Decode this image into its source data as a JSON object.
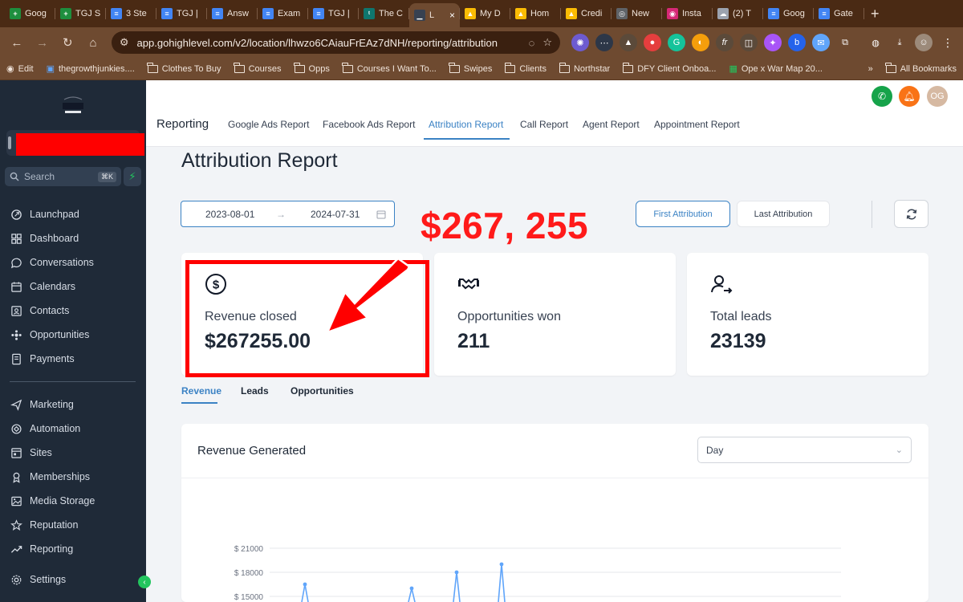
{
  "browser": {
    "tabs": [
      {
        "label": "Goog",
        "fav_color": "#1e8e3e",
        "fav_glyph": "+"
      },
      {
        "label": "TGJ S",
        "fav_color": "#1e8e3e",
        "fav_glyph": "+"
      },
      {
        "label": "3 Ste",
        "fav_color": "#4285f4",
        "fav_glyph": "≡"
      },
      {
        "label": "TGJ |",
        "fav_color": "#4285f4",
        "fav_glyph": "≡"
      },
      {
        "label": "Answ",
        "fav_color": "#4285f4",
        "fav_glyph": "≡"
      },
      {
        "label": "Exam",
        "fav_color": "#4285f4",
        "fav_glyph": "≡"
      },
      {
        "label": "TGJ |",
        "fav_color": "#4285f4",
        "fav_glyph": "≡"
      },
      {
        "label": "The C",
        "fav_color": "#0f766e",
        "fav_glyph": "ᵗ"
      },
      {
        "label": "L",
        "fav_color": "#374151",
        "fav_glyph": "▁",
        "active": true
      },
      {
        "label": "My D",
        "fav_color": "#fbbc04",
        "fav_glyph": "▲"
      },
      {
        "label": "Hom",
        "fav_color": "#fbbc04",
        "fav_glyph": "▲"
      },
      {
        "label": "Credi",
        "fav_color": "#fbbc04",
        "fav_glyph": "▲"
      },
      {
        "label": "New",
        "fav_color": "#5f6368",
        "fav_glyph": "◎"
      },
      {
        "label": "Insta",
        "fav_color": "#d62976",
        "fav_glyph": "◉"
      },
      {
        "label": "(2) T",
        "fav_color": "#9ca3af",
        "fav_glyph": "☁"
      },
      {
        "label": "Goog",
        "fav_color": "#4285f4",
        "fav_glyph": "≡"
      },
      {
        "label": "Gate",
        "fav_color": "#4285f4",
        "fav_glyph": "≡"
      }
    ],
    "url": "app.gohighlevel.com/v2/location/lhwzo6CAiauFrEAz7dNH/reporting/attribution",
    "bookmarks": [
      {
        "label": "Edit",
        "kind": "globe"
      },
      {
        "label": "thegrowthjunkies....",
        "kind": "app"
      },
      {
        "label": "Clothes To Buy",
        "kind": "folder"
      },
      {
        "label": "Courses",
        "kind": "folder"
      },
      {
        "label": "Opps",
        "kind": "folder"
      },
      {
        "label": "Courses I Want To...",
        "kind": "folder"
      },
      {
        "label": "Swipes",
        "kind": "folder"
      },
      {
        "label": "Clients",
        "kind": "folder"
      },
      {
        "label": "Northstar",
        "kind": "folder"
      },
      {
        "label": "DFY Client Onboa...",
        "kind": "folder"
      },
      {
        "label": "Ope x War Map 20...",
        "kind": "sheet"
      }
    ],
    "more_bookmarks": "»",
    "all_bookmarks": "All Bookmarks"
  },
  "sidebar": {
    "search_placeholder": "Search",
    "search_shortcut": "⌘K",
    "items_top": [
      {
        "label": "Launchpad",
        "icon": "rocket-icon"
      },
      {
        "label": "Dashboard",
        "icon": "grid-icon"
      },
      {
        "label": "Conversations",
        "icon": "chat-icon"
      },
      {
        "label": "Calendars",
        "icon": "calendar-icon"
      },
      {
        "label": "Contacts",
        "icon": "contacts-icon"
      },
      {
        "label": "Opportunities",
        "icon": "opportunities-icon"
      },
      {
        "label": "Payments",
        "icon": "payments-icon"
      }
    ],
    "items_bottom": [
      {
        "label": "Marketing",
        "icon": "send-icon"
      },
      {
        "label": "Automation",
        "icon": "automation-icon"
      },
      {
        "label": "Sites",
        "icon": "sites-icon"
      },
      {
        "label": "Memberships",
        "icon": "memberships-icon"
      },
      {
        "label": "Media Storage",
        "icon": "media-icon"
      },
      {
        "label": "Reputation",
        "icon": "star-icon"
      },
      {
        "label": "Reporting",
        "icon": "trend-icon"
      }
    ],
    "settings_label": "Settings"
  },
  "header": {
    "section": "Reporting",
    "tabs": [
      "Google Ads Report",
      "Facebook Ads Report",
      "Attribution Report",
      "Call Report",
      "Agent Report",
      "Appointment Report"
    ],
    "active_tab": "Attribution Report",
    "avatar_initials": "OG"
  },
  "main": {
    "title": "Attribution Report",
    "date_start": "2023-08-01",
    "date_end": "2024-07-31",
    "first_attribution": "First Attribution",
    "last_attribution": "Last Attribution",
    "annotation_text": "$267, 255",
    "cards": [
      {
        "label": "Revenue closed",
        "value": "$267255.00",
        "icon": "dollar-circle-icon"
      },
      {
        "label": "Opportunities won",
        "value": "211",
        "icon": "handshake-icon"
      },
      {
        "label": "Total leads",
        "value": "23139",
        "icon": "user-arrow-icon"
      }
    ],
    "subtabs": [
      "Revenue",
      "Leads",
      "Opportunities"
    ],
    "active_subtab": "Revenue"
  },
  "chart_data": {
    "type": "line",
    "title": "Revenue Generated",
    "granularity": "Day",
    "y_ticks": [
      "$ 21000",
      "$ 18000",
      "$ 15000"
    ],
    "y_tick_values": [
      21000,
      18000,
      15000
    ],
    "ylim": [
      15000,
      21000
    ],
    "visible_spikes": [
      16500,
      16000,
      18000,
      19000
    ],
    "line_color": "#60a5fa",
    "grid": true
  }
}
